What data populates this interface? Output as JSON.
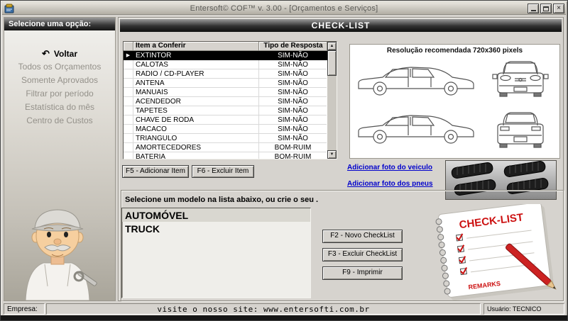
{
  "window": {
    "title": "Entersoft© COF™ v. 3.00 - [Orçamentos e Serviços]"
  },
  "icons": {
    "back_arrow": "↶",
    "row_pointer": "▶",
    "scroll_up": "▲",
    "scroll_down": "▼",
    "close": "×"
  },
  "sidebar": {
    "header": "Selecione uma opção:",
    "items": [
      {
        "label": "Voltar"
      },
      {
        "label": "Todos os Orçamentos"
      },
      {
        "label": "Somente Aprovados"
      },
      {
        "label": "Filtrar por período"
      },
      {
        "label": "Estatística do mês"
      },
      {
        "label": "Centro de Custos"
      }
    ]
  },
  "main": {
    "header": "CHECK-LIST",
    "table": {
      "columns": [
        "Item a Conferir",
        "Tipo de Resposta"
      ],
      "rows": [
        [
          "EXTINTOR",
          "SIM-NÃO"
        ],
        [
          "CALOTAS",
          "SIM-NÃO"
        ],
        [
          "RADIO / CD-PLAYER",
          "SIM-NÃO"
        ],
        [
          "ANTENA",
          "SIM-NÃO"
        ],
        [
          "MANUAIS",
          "SIM-NÃO"
        ],
        [
          "ACENDEDOR",
          "SIM-NÃO"
        ],
        [
          "TAPETES",
          "SIM-NÃO"
        ],
        [
          "CHAVE DE RODA",
          "SIM-NÃO"
        ],
        [
          "MACACO",
          "SIM-NÃO"
        ],
        [
          "TRIANGULO",
          "SIM-NÃO"
        ],
        [
          "AMORTECEDORES",
          "BOM-RUIM"
        ],
        [
          "BATERIA",
          "BOM-RUIM"
        ]
      ],
      "selected_row": "EXTINTOR"
    },
    "photo_panel": {
      "note": "Resolução recomendada 720x360 pixels"
    },
    "buttons": {
      "add_item": "F5 - Adicionar Item",
      "remove_item": "F6 - Excluir Item",
      "new_checklist": "F2 - Novo CheckList",
      "delete_checklist": "F3 - Excluir CheckList",
      "print": "F9 - Imprimir"
    },
    "links": {
      "vehicle_photo": "Adicionar foto do veiculo",
      "tire_photos": "Adicionar foto dos pneus"
    },
    "models_label": "Selecione um modelo na lista abaixo, ou crie o seu .",
    "models": [
      "AUTOMÓVEL",
      "TRUCK"
    ]
  },
  "illustration": {
    "notebook_title": "CHECK-LIST",
    "notebook_remarks": "REMARKS"
  },
  "statusbar": {
    "company_label": "Empresa:",
    "site_text": "visite o nosso site: www.entersofti.com.br",
    "user": "Usuário: TECNICO"
  },
  "colors": {
    "window_chrome": "#d6d3ce",
    "header_dark": "#1c1c1c",
    "link_blue": "#0000cc",
    "selection": "#000000"
  }
}
